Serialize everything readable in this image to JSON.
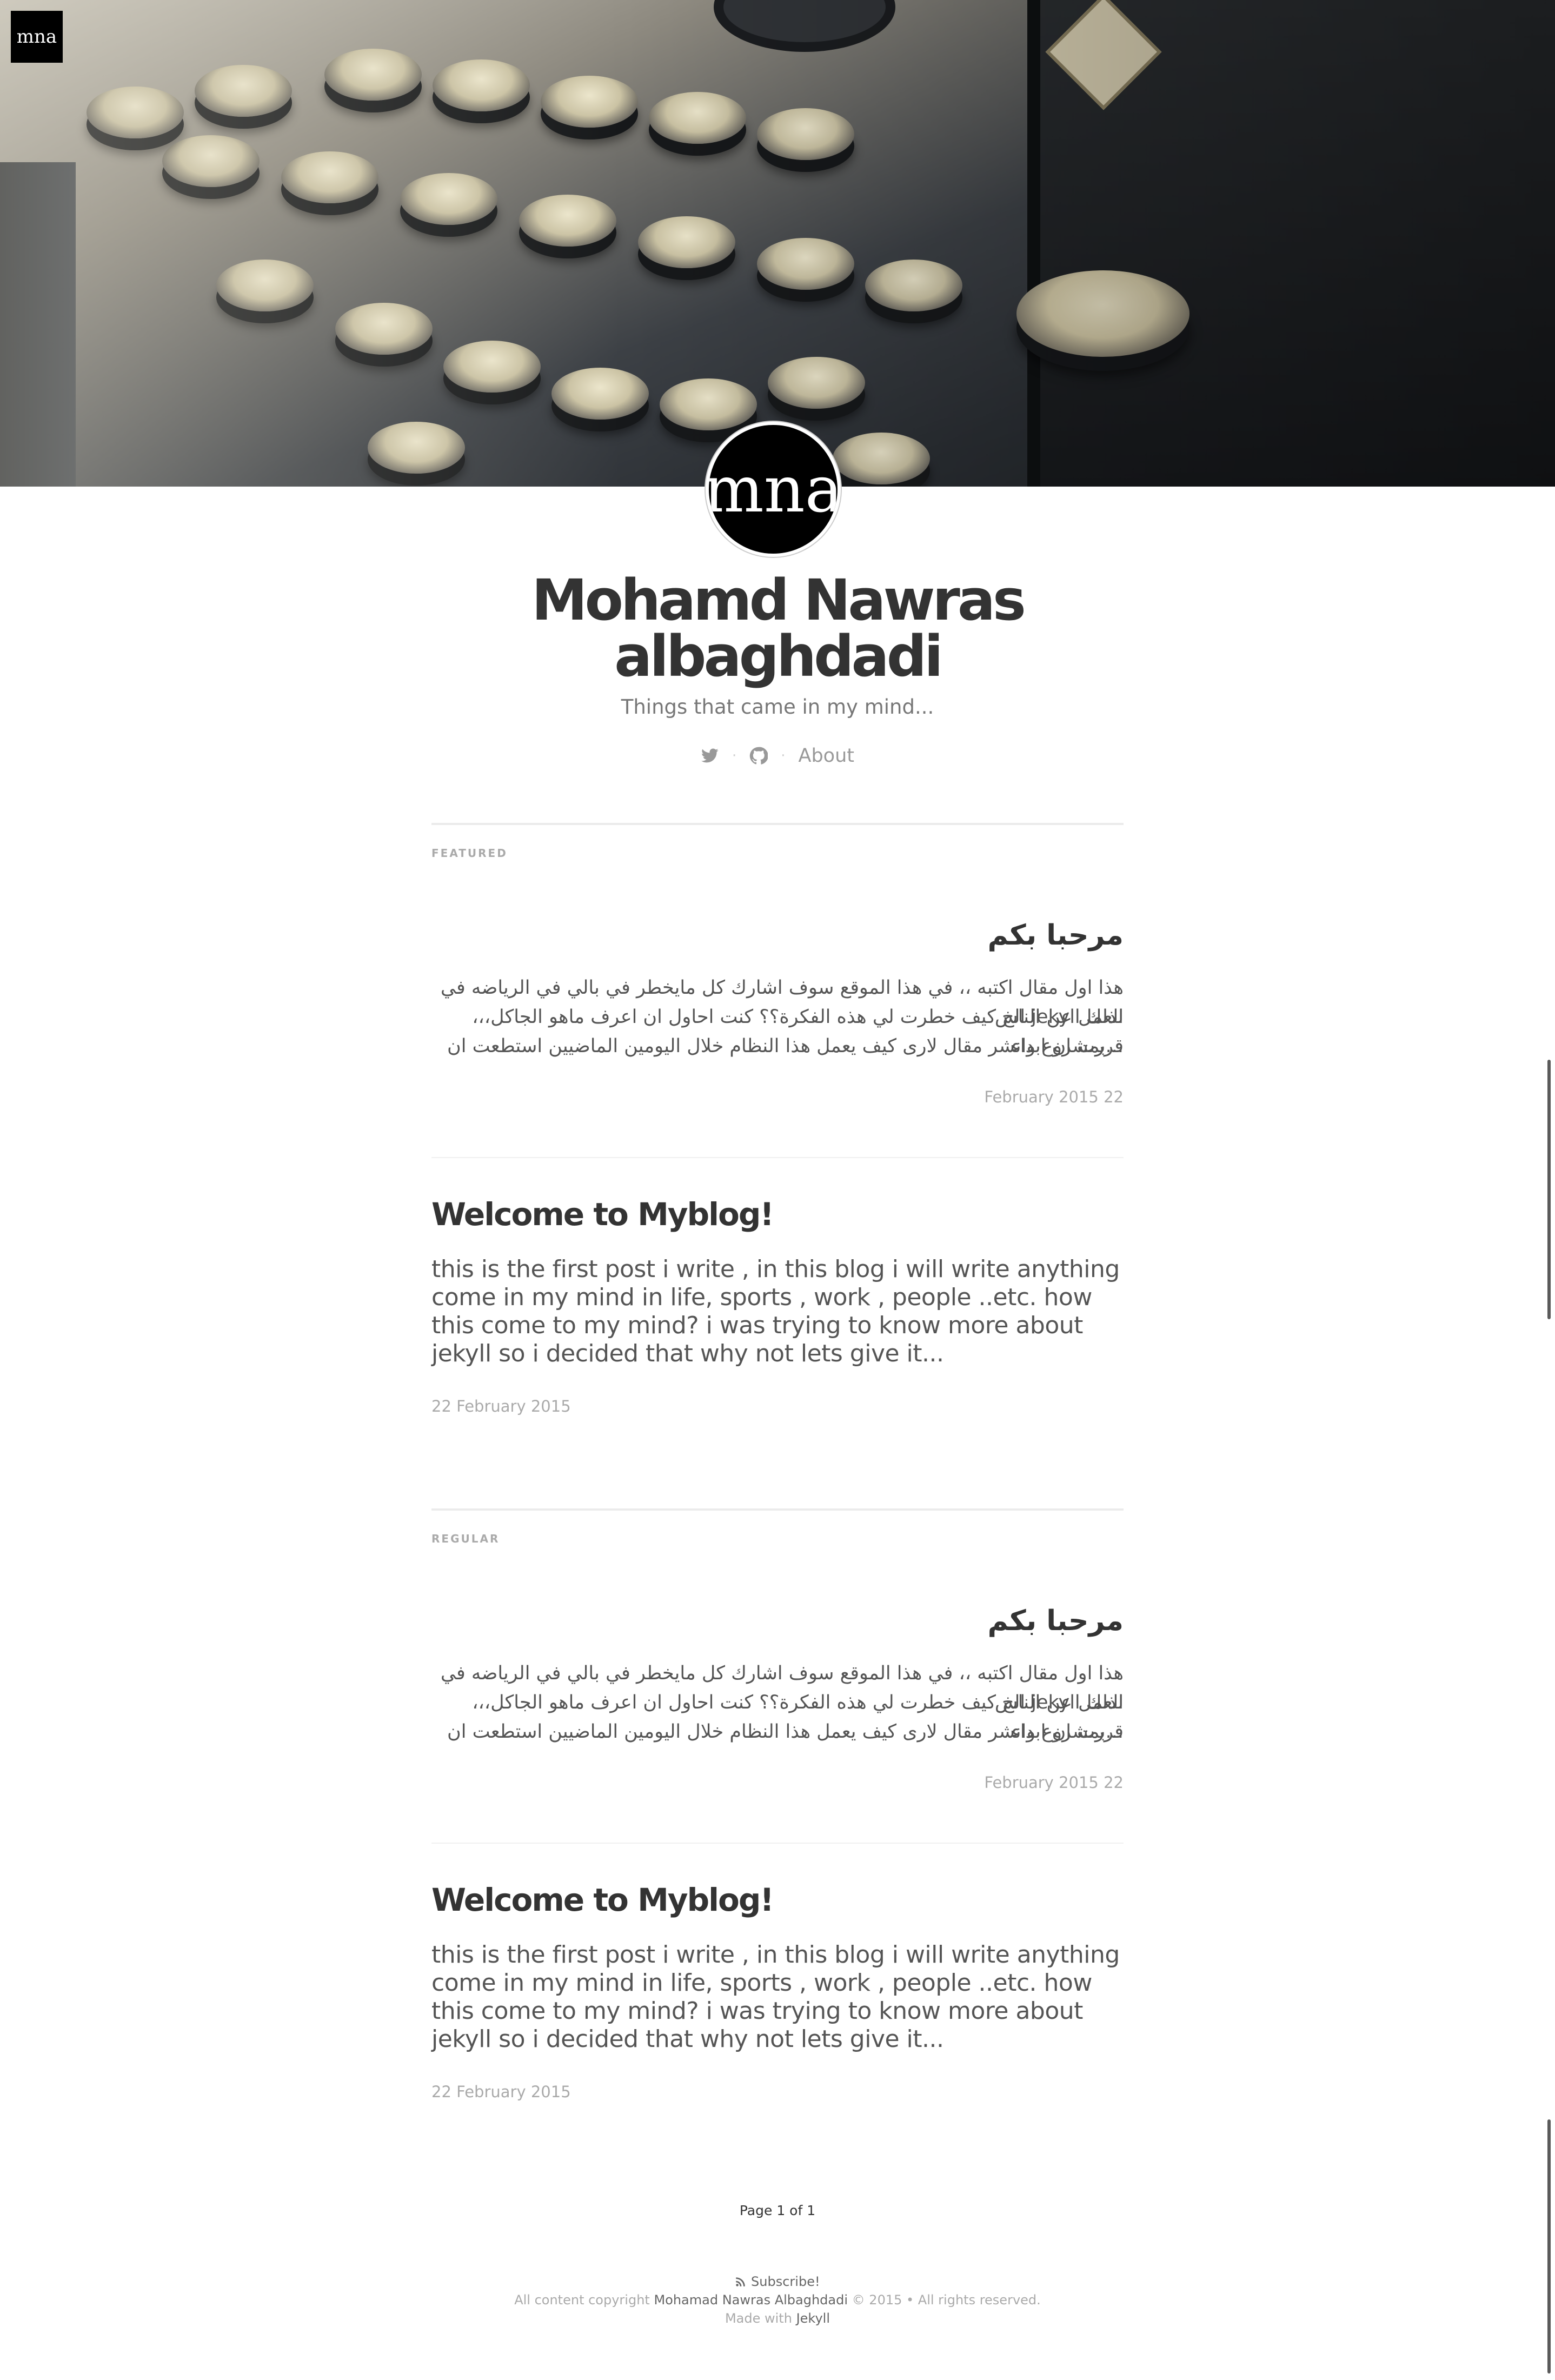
{
  "site": {
    "logo_text": "mna",
    "avatar_text": "mna",
    "title": "Mohamd Nawras albaghdadi",
    "description": "Things that came in my mind...",
    "nav": {
      "twitter_icon": "twitter-icon",
      "github_icon": "github-icon",
      "separator": "·",
      "about_label": "About"
    }
  },
  "sections": {
    "featured_label": "FEATURED",
    "regular_label": "REGULAR"
  },
  "posts": {
    "featured": [
      {
        "title": "مرحبا بكم",
        "excerpt_line1": "هذا اول مقال اكتبه ،، في هذا الموقع سوف اشارك كل مايخطر في بالي في الرياضه في العمل عن الناس",
        "excerpt_line2": "،،،الخ كيف خطرت لي هذه الفكرة؟؟ كنت احاول ان اعرف ماهو الجاكل jekyll لذلك قررت ان ابداء",
        "excerpt_line3": "بمشروع وانشر مقال لارى كيف يعمل هذا النظام خلال اليومين الماضيين استطعت ان...",
        "date": "February 2015 22"
      },
      {
        "title": "Welcome to Myblog!",
        "excerpt": "this is the first post i write , in this blog i will write anything come in my mind in life, sports , work , people ..etc. how this come to my mind? i was trying to know more about jekyll so i decided that why not lets give it...",
        "date": "22 February 2015"
      }
    ],
    "regular": [
      {
        "title": "مرحبا بكم",
        "excerpt_line1": "هذا اول مقال اكتبه ،، في هذا الموقع سوف اشارك كل مايخطر في بالي في الرياضه في العمل عن الناس",
        "excerpt_line2": "،،،الخ كيف خطرت لي هذه الفكرة؟؟ كنت احاول ان اعرف ماهو الجاكل jekyll لذلك قررت ان ابداء",
        "excerpt_line3": "بمشروع وانشر مقال لارى كيف يعمل هذا النظام خلال اليومين الماضيين استطعت ان...",
        "date": "February 2015 22"
      },
      {
        "title": "Welcome to Myblog!",
        "excerpt": "this is the first post i write , in this blog i will write anything come in my mind in life, sports , work , people ..etc. how this come to my mind? i was trying to know more about jekyll so i decided that why not lets give it...",
        "date": "22 February 2015"
      }
    ]
  },
  "pagination": {
    "text": "Page 1 of 1"
  },
  "footer": {
    "subscribe_icon": "rss-icon",
    "subscribe_label": "Subscribe!",
    "copyright_prefix": "All content copyright",
    "copyright_name": "Mohamad Nawras Albaghdadi",
    "copyright_suffix": "© 2015 • All rights reserved.",
    "made_with_prefix": "Made with",
    "made_with_link": "Jekyll"
  }
}
